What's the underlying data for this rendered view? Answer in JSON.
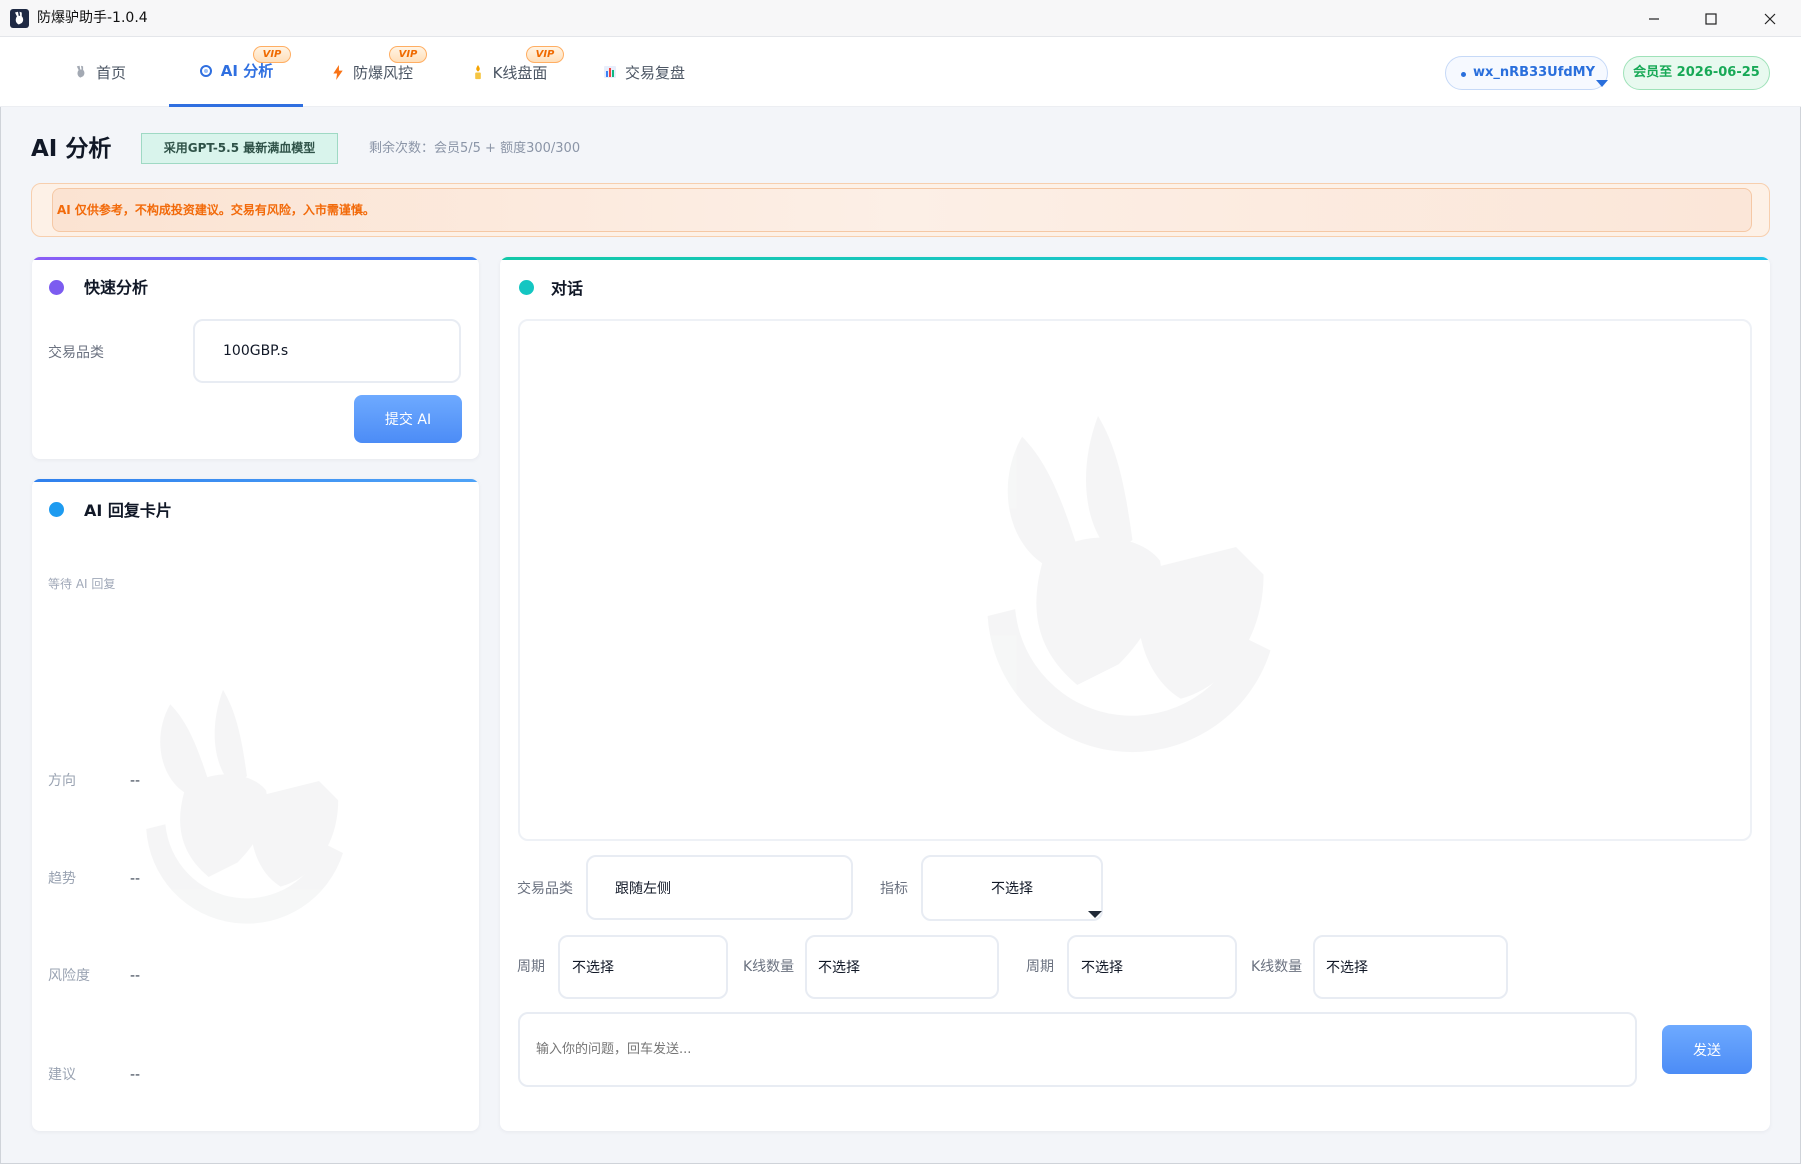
{
  "window": {
    "title": "防爆驴助手-1.0.4",
    "logo_icon": "donkey-logo-icon",
    "controls": [
      "minimize-icon",
      "maximize-icon",
      "close-icon"
    ]
  },
  "nav": {
    "tabs": [
      {
        "label": "首页",
        "icon": "donkey-icon",
        "active": false
      },
      {
        "label": "AI 分析",
        "icon": "ai-ring-icon",
        "vip": "VIP",
        "active": true
      },
      {
        "label": "防爆风控",
        "icon": "lightning-icon",
        "vip": "VIP",
        "active": false
      },
      {
        "label": "K线盘面",
        "icon": "candle-icon",
        "vip": "VIP",
        "active": false
      },
      {
        "label": "交易复盘",
        "icon": "bar-chart-icon",
        "active": false
      }
    ],
    "user": {
      "name": "wx_nRB33UfdMY",
      "icon": "chevron-down-icon"
    },
    "membership": "会员至 2026-06-25"
  },
  "header": {
    "title": "AI 分析",
    "model_badge": "采用GPT-5.5 最新满血模型",
    "quota": "剩余次数：会员5/5 + 额度300/300"
  },
  "disclaimer": "AI 仅供参考，不构成投资建议。交易有风险，入市需谨慎。",
  "quick_analysis": {
    "title": "快速分析",
    "symbol_label": "交易品类",
    "symbol_value": "100GBP.s",
    "submit_label": "提交 AI"
  },
  "reply_card": {
    "title": "AI 回复卡片",
    "status": "等待 AI 回复",
    "fields": [
      {
        "label": "方向",
        "value": "--"
      },
      {
        "label": "趋势",
        "value": "--"
      },
      {
        "label": "风险度",
        "value": "--"
      },
      {
        "label": "建议",
        "value": "--"
      }
    ]
  },
  "chat": {
    "title": "对话",
    "symbol_label": "交易品类",
    "symbol_value": "跟随左侧",
    "indicator_label": "指标",
    "indicator_value": "不选择",
    "timeframes": [
      {
        "period_label": "周期",
        "period_value": "不选择",
        "count_label": "K线数量",
        "count_value": "不选择"
      },
      {
        "period_label": "周期",
        "period_value": "不选择",
        "count_label": "K线数量",
        "count_value": "不选择"
      }
    ],
    "input_placeholder": "输入你的问题，回车发送...",
    "send_label": "发送"
  },
  "colors": {
    "accent": "#2f6fe0",
    "vip": "#f06a00",
    "membership": "#18a957",
    "warning": "#f26a0a",
    "quick_dot": "#7c5cf0",
    "reply_dot": "#1e9bf0",
    "chat_dot": "#14c6c2"
  }
}
